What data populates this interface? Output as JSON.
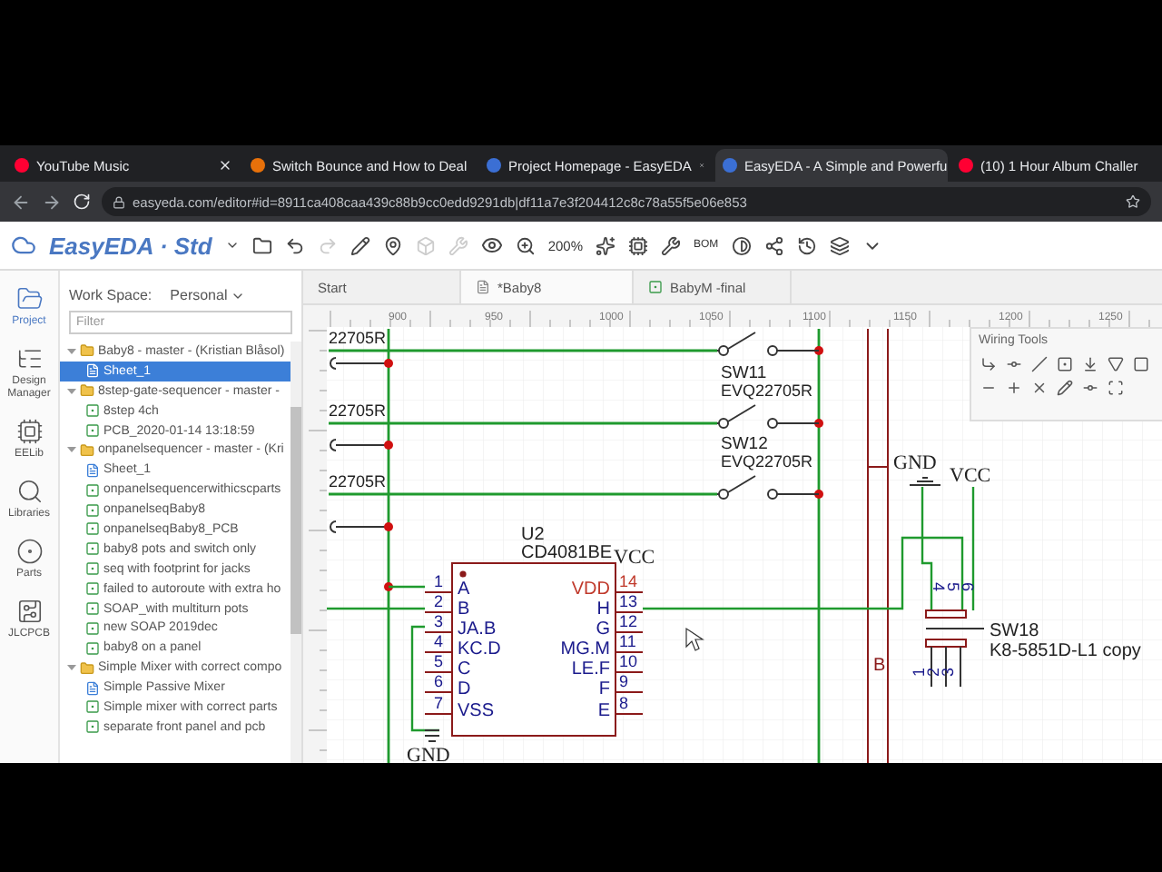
{
  "browser": {
    "tabs": [
      {
        "title": "YouTube Music",
        "selected": false,
        "color": "#ff0033"
      },
      {
        "title": "Switch Bounce and How to Deal",
        "selected": false,
        "color": "#e8710a"
      },
      {
        "title": "Project Homepage - EasyEDA",
        "selected": false,
        "color": "#3b6fd4"
      },
      {
        "title": "EasyEDA - A Simple and Powerfu",
        "selected": true,
        "color": "#3b6fd4"
      },
      {
        "title": "(10) 1 Hour Album Challer",
        "selected": false,
        "color": "#ff0033"
      }
    ],
    "url": "easyeda.com/editor#id=8911ca408caa439c88b9cc0edd9291db|df11a7e3f204412c8c78a55f5e06e853"
  },
  "app": {
    "logo": "EasyEDA · Std",
    "zoom": "200%",
    "bom": "BOM"
  },
  "rail": [
    {
      "label": "Project",
      "kind": "project",
      "selected": true
    },
    {
      "label": "Design Manager",
      "kind": "manager",
      "selected": false
    },
    {
      "label": "EELib",
      "kind": "eelib",
      "selected": false
    },
    {
      "label": "Libraries",
      "kind": "libraries",
      "selected": false
    },
    {
      "label": "Parts",
      "kind": "parts",
      "selected": false
    },
    {
      "label": "JLCPCB",
      "kind": "jlcpcb",
      "selected": false
    }
  ],
  "workspace": {
    "label": "Work Space:",
    "value": "Personal"
  },
  "filter": {
    "placeholder": "Filter"
  },
  "tree": [
    {
      "label": "Baby8 - master - (Kristian Blåsol)",
      "kind": "folder",
      "expanded": true,
      "selected": false,
      "children": [
        {
          "label": "Sheet_1",
          "kind": "schematic",
          "selected": true
        }
      ]
    },
    {
      "label": "8step-gate-sequencer - master -",
      "kind": "folder",
      "expanded": true,
      "selected": false,
      "children": [
        {
          "label": "8step 4ch",
          "kind": "pcb",
          "selected": false
        },
        {
          "label": "PCB_2020-01-14 13:18:59",
          "kind": "pcb",
          "selected": false
        }
      ]
    },
    {
      "label": "onpanelsequencer - master - (Kri",
      "kind": "folder",
      "expanded": true,
      "selected": false,
      "children": [
        {
          "label": "Sheet_1",
          "kind": "schematic",
          "selected": false
        },
        {
          "label": "onpanelsequencerwithicscparts",
          "kind": "pcb",
          "selected": false
        },
        {
          "label": "onpanelseqBaby8",
          "kind": "pcb",
          "selected": false
        },
        {
          "label": "onpanelseqBaby8_PCB",
          "kind": "pcb",
          "selected": false
        },
        {
          "label": "baby8 pots and switch only",
          "kind": "pcb",
          "selected": false
        },
        {
          "label": "seq with footprint for jacks",
          "kind": "pcb",
          "selected": false
        },
        {
          "label": "failed to autoroute with extra ho",
          "kind": "pcb",
          "selected": false
        },
        {
          "label": "SOAP_with multiturn pots",
          "kind": "pcb",
          "selected": false
        },
        {
          "label": "new SOAP 2019dec",
          "kind": "pcb",
          "selected": false
        },
        {
          "label": "baby8 on a panel",
          "kind": "pcb",
          "selected": false
        }
      ]
    },
    {
      "label": "Simple Mixer with correct compo",
      "kind": "folder",
      "expanded": true,
      "selected": false,
      "children": [
        {
          "label": "Simple Passive Mixer",
          "kind": "schematic",
          "selected": false
        },
        {
          "label": "Simple mixer with correct parts",
          "kind": "pcb",
          "selected": false
        },
        {
          "label": "separate front panel and pcb",
          "kind": "pcb",
          "selected": false
        }
      ]
    }
  ],
  "doc_tabs": [
    {
      "label": "Start",
      "kind": "start",
      "selected": false
    },
    {
      "label": "*Baby8",
      "kind": "schematic",
      "selected": true
    },
    {
      "label": "BabyM -final",
      "kind": "pcb",
      "selected": false
    }
  ],
  "ruler": [
    "900",
    "950",
    "1000",
    "1050",
    "1100",
    "1150",
    "1200",
    "1250"
  ],
  "schematic": {
    "wire_labels": [
      "22705R",
      "22705R",
      "22705R"
    ],
    "switches": [
      {
        "ref": "SW11",
        "part": "EVQ22705R"
      },
      {
        "ref": "SW12",
        "part": "EVQ22705R"
      }
    ],
    "chip": {
      "ref": "U2",
      "part": "CD4081BE",
      "power_label": "VCC",
      "ground_label": "GND",
      "left_pins": [
        {
          "num": "1",
          "name": "A",
          "color": "#1a1a8c"
        },
        {
          "num": "2",
          "name": "B",
          "color": "#1a1a8c"
        },
        {
          "num": "3",
          "name": "JA.B",
          "color": "#1a1a8c"
        },
        {
          "num": "4",
          "name": "KC.D",
          "color": "#1a1a8c"
        },
        {
          "num": "5",
          "name": "C",
          "color": "#1a1a8c"
        },
        {
          "num": "6",
          "name": "D",
          "color": "#1a1a8c"
        },
        {
          "num": "7",
          "name": "VSS",
          "color": "#1a1a8c"
        }
      ],
      "right_pins": [
        {
          "num": "14",
          "name": "VDD",
          "color": "#c0392b"
        },
        {
          "num": "13",
          "name": "H",
          "color": "#1a1a8c"
        },
        {
          "num": "12",
          "name": "G",
          "color": "#1a1a8c"
        },
        {
          "num": "11",
          "name": "MG.M",
          "color": "#1a1a8c"
        },
        {
          "num": "10",
          "name": "LE.F",
          "color": "#1a1a8c"
        },
        {
          "num": "9",
          "name": "F",
          "color": "#1a1a8c"
        },
        {
          "num": "8",
          "name": "E",
          "color": "#1a1a8c"
        }
      ]
    },
    "bus_label": "B",
    "sw18": {
      "ref": "SW18",
      "part": "K8-5851D-L1 copy",
      "ground_label": "GND",
      "power_label": "VCC",
      "top_pins": [
        "4",
        "5",
        "6"
      ],
      "bottom_pins": [
        "1",
        "2",
        "3"
      ]
    }
  },
  "wiring_tools": {
    "title": "Wiring Tools"
  }
}
